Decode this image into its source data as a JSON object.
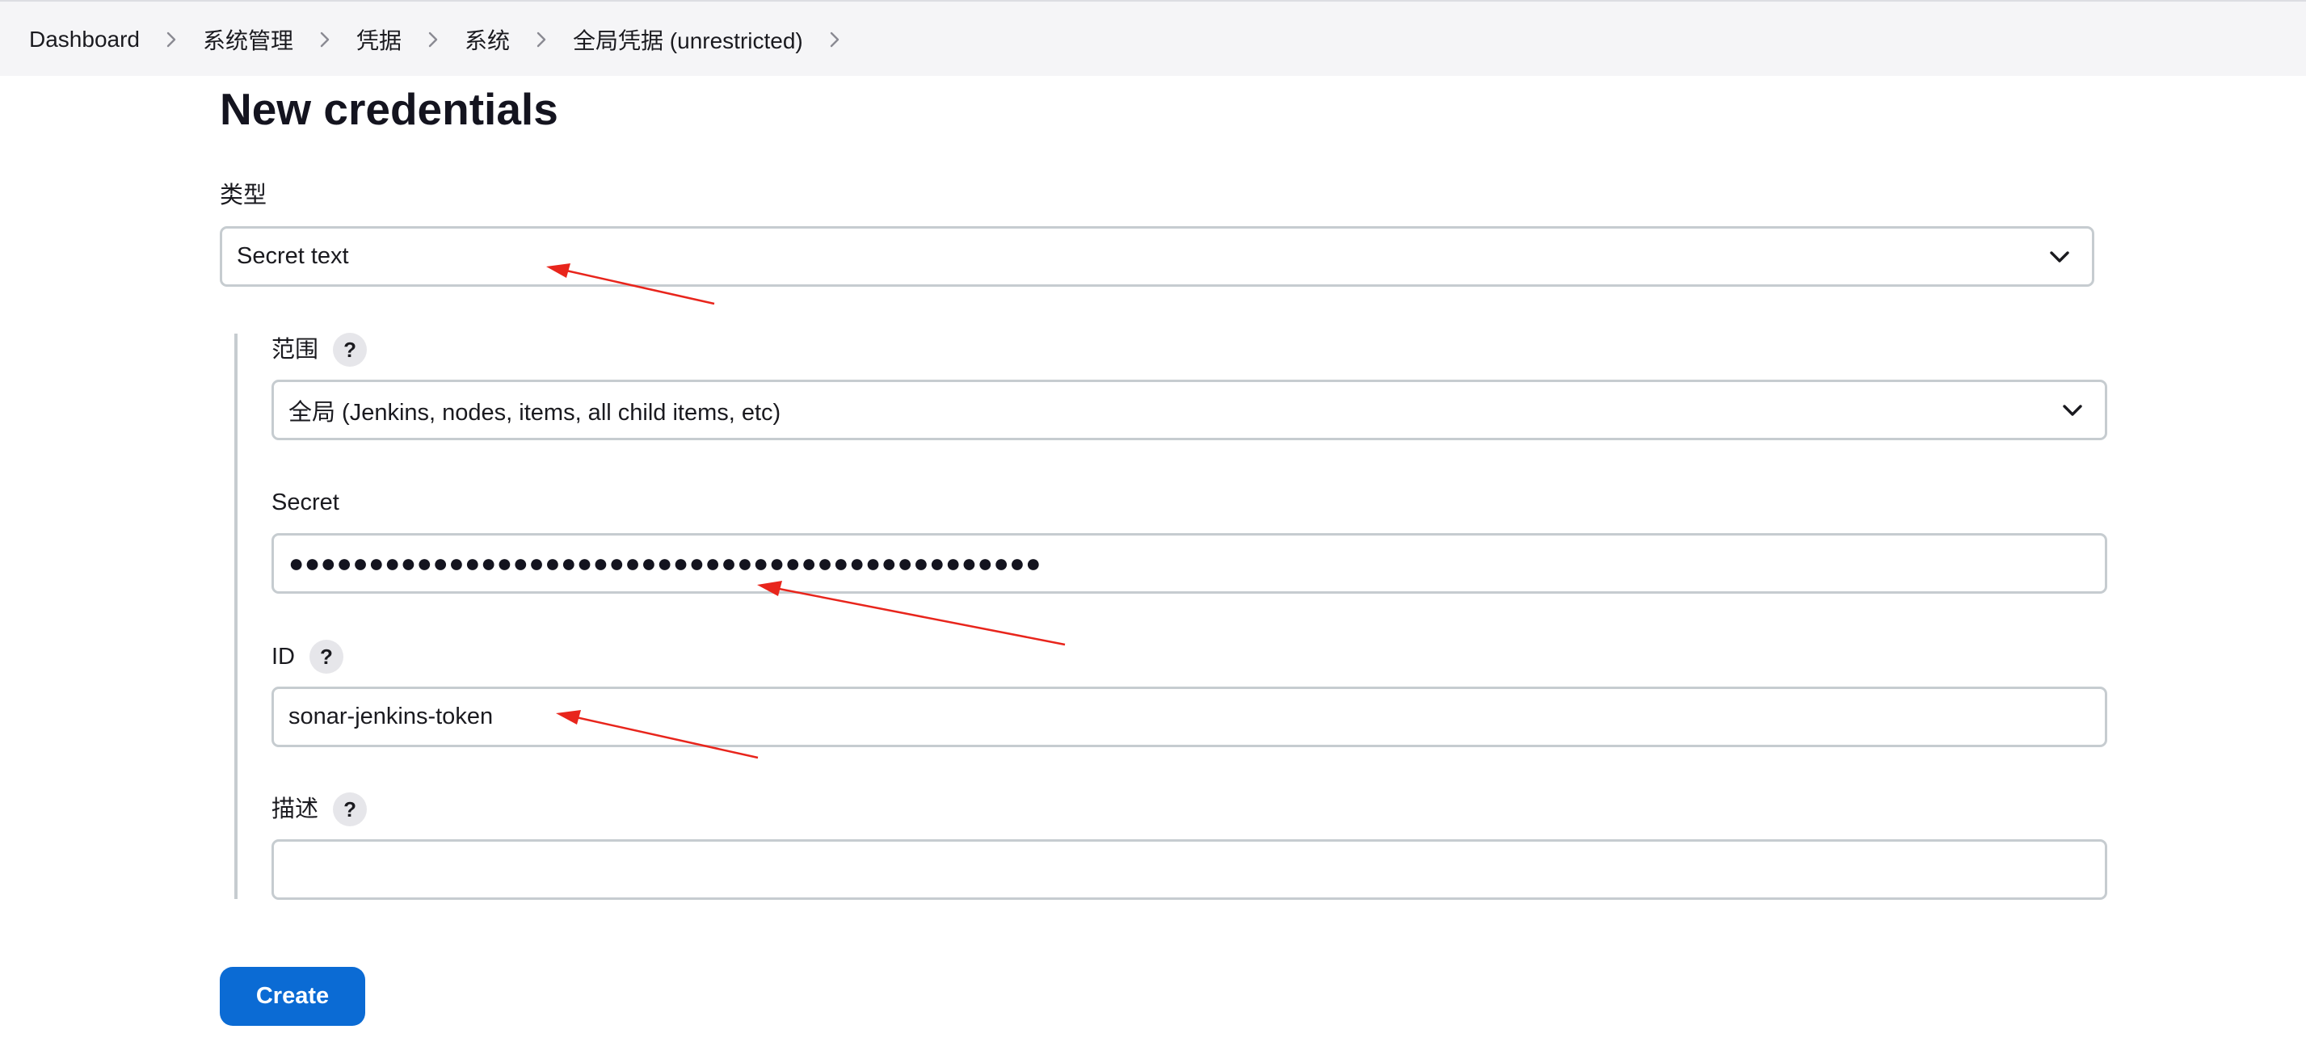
{
  "breadcrumb": [
    {
      "label": "Dashboard"
    },
    {
      "label": "系统管理"
    },
    {
      "label": "凭据"
    },
    {
      "label": "系统"
    },
    {
      "label": "全局凭据 (unrestricted)"
    }
  ],
  "page": {
    "title": "New credentials"
  },
  "form": {
    "type": {
      "label": "类型",
      "value": "Secret text"
    },
    "scope": {
      "label": "范围",
      "help": "?",
      "value": "全局 (Jenkins, nodes, items, all child items, etc)"
    },
    "secret": {
      "label": "Secret",
      "value": "●●●●●●●●●●●●●●●●●●●●●●●●●●●●●●●●●●●●●●●●●●●●●●●"
    },
    "id": {
      "label": "ID",
      "help": "?",
      "value": "sonar-jenkins-token"
    },
    "description": {
      "label": "描述",
      "help": "?",
      "value": ""
    }
  },
  "actions": {
    "create_label": "Create"
  },
  "colors": {
    "primary_button": "#0b6bd4",
    "annotation_arrow": "#e8251c",
    "breadcrumb_bg": "#f5f5f7",
    "input_border": "#c6ccd0"
  },
  "icons": {
    "breadcrumb_separator": "chevron-right-icon",
    "dropdown": "chevron-down-icon",
    "help": "help-icon"
  }
}
